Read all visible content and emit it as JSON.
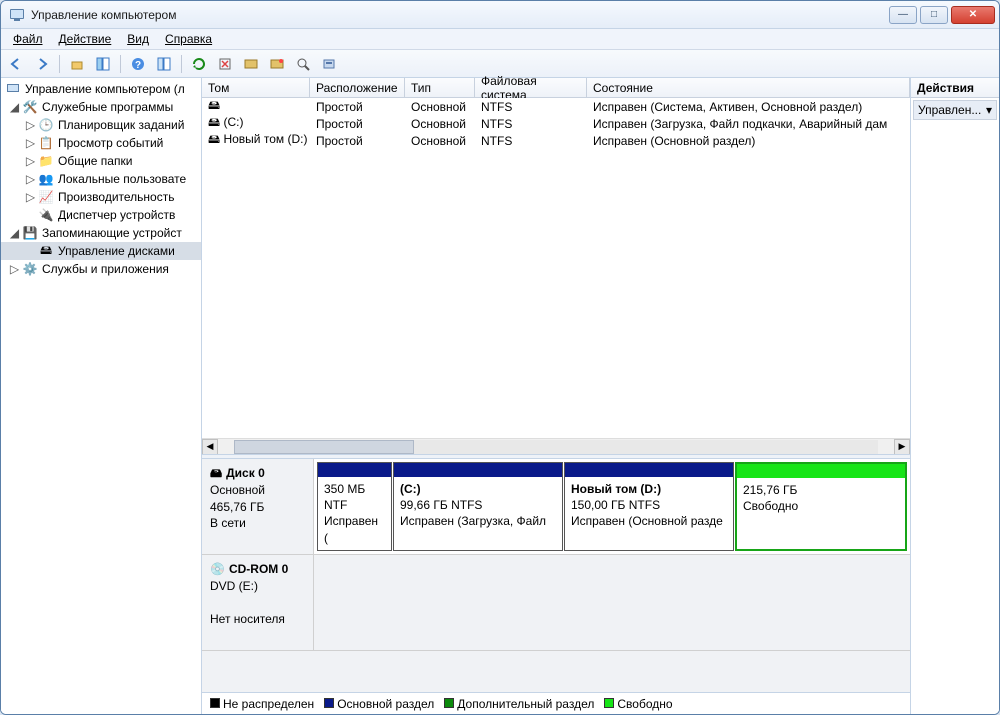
{
  "window": {
    "title": "Управление компьютером"
  },
  "menu": {
    "file": "Файл",
    "action": "Действие",
    "view": "Вид",
    "help": "Справка"
  },
  "tree": {
    "root": "Управление компьютером (л",
    "group_utils": "Служебные программы",
    "scheduler": "Планировщик заданий",
    "events": "Просмотр событий",
    "shared": "Общие папки",
    "users": "Локальные пользовате",
    "perf": "Производительность",
    "devmgr": "Диспетчер устройств",
    "group_storage": "Запоминающие устройст",
    "diskmgmt": "Управление дисками",
    "group_services": "Службы и приложения"
  },
  "columns": {
    "volume": "Том",
    "layout": "Расположение",
    "type": "Тип",
    "fs": "Файловая система",
    "status": "Состояние"
  },
  "volumes": [
    {
      "name": "",
      "layout": "Простой",
      "type": "Основной",
      "fs": "NTFS",
      "status": "Исправен (Система, Активен, Основной раздел)"
    },
    {
      "name": "(C:)",
      "layout": "Простой",
      "type": "Основной",
      "fs": "NTFS",
      "status": "Исправен (Загрузка, Файл подкачки, Аварийный дам"
    },
    {
      "name": "Новый том (D:)",
      "layout": "Простой",
      "type": "Основной",
      "fs": "NTFS",
      "status": "Исправен (Основной раздел)"
    }
  ],
  "disks": {
    "d0": {
      "title": "Диск 0",
      "line1": "Основной",
      "line2": "465,76 ГБ",
      "line3": "В сети",
      "p0": {
        "l1": "",
        "l2": "350 МБ NTF",
        "l3": "Исправен ("
      },
      "p1": {
        "l1": "(C:)",
        "l2": "99,66 ГБ NTFS",
        "l3": "Исправен (Загрузка, Файл"
      },
      "p2": {
        "l1": "Новый том  (D:)",
        "l2": "150,00 ГБ NTFS",
        "l3": "Исправен (Основной разде"
      },
      "p3": {
        "l1": "",
        "l2": "215,76 ГБ",
        "l3": "Свободно"
      }
    },
    "cd": {
      "title": "CD-ROM 0",
      "line1": "DVD (E:)",
      "line2": "Нет носителя"
    }
  },
  "legend": {
    "unalloc": "Не распределен",
    "primary": "Основной раздел",
    "ext": "Дополнительный раздел",
    "free": "Свободно"
  },
  "actions": {
    "header": "Действия",
    "item": "Управлен..."
  },
  "colors": {
    "primary": "#0a1a8a",
    "free": "#17e517",
    "ext": "#0b8a0b",
    "unalloc": "#000000"
  }
}
